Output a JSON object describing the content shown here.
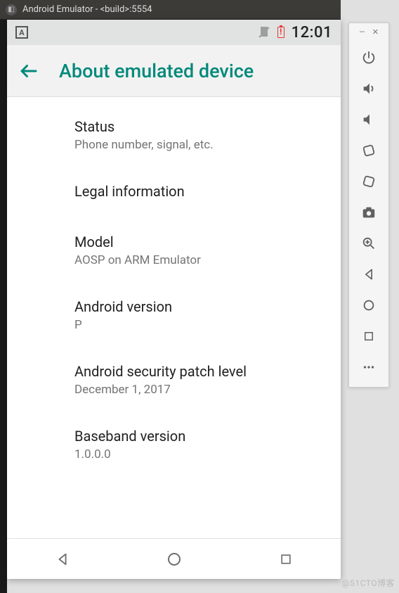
{
  "host": {
    "title": "Android Emulator - <build>:5554"
  },
  "statusbar": {
    "indicator": "A",
    "clock": "12:01"
  },
  "appbar": {
    "title": "About emulated device"
  },
  "settings": [
    {
      "primary": "Status",
      "secondary": "Phone number, signal, etc."
    },
    {
      "primary": "Legal information",
      "secondary": ""
    },
    {
      "primary": "Model",
      "secondary": "AOSP on ARM Emulator"
    },
    {
      "primary": "Android version",
      "secondary": "P"
    },
    {
      "primary": "Android security patch level",
      "secondary": "December 1, 2017"
    },
    {
      "primary": "Baseband version",
      "secondary": "1.0.0.0"
    }
  ],
  "watermark": "@51CTO博客"
}
